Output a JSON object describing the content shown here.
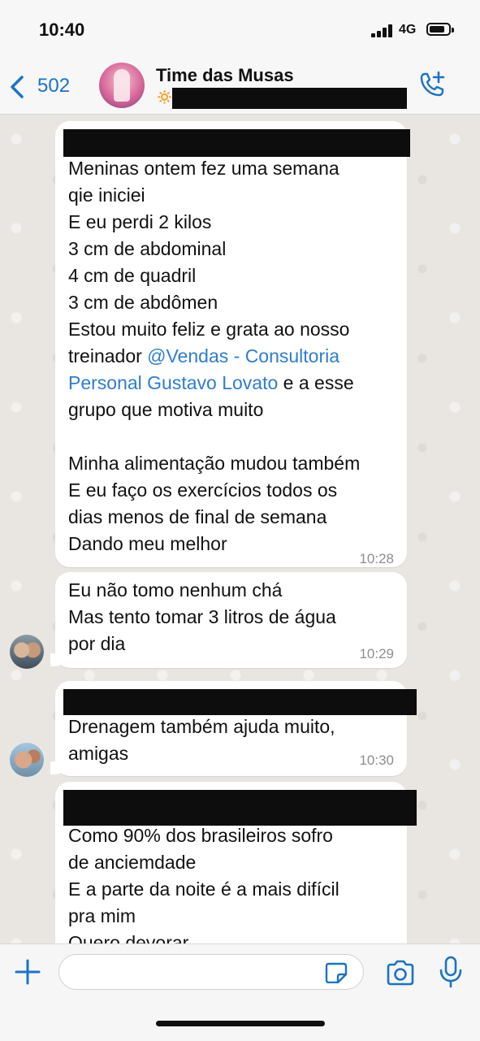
{
  "status_bar": {
    "time": "10:40",
    "network": "4G"
  },
  "header": {
    "back_count": "502",
    "title": "Time das Musas",
    "subtitle_emoji": "🔅"
  },
  "messages": [
    {
      "lines": [
        "Meninas ontem fez uma semana",
        "qie iniciei",
        "E eu perdi 2 kilos",
        "3 cm de abdominal",
        "4 cm de quadril",
        "3 cm de abdômen",
        "Estou muito feliz e grata ao nosso"
      ],
      "mention_prefix": "treinador ",
      "mention_a": "@Vendas - Consultoria",
      "mention_b": "Personal Gustavo Lovato",
      "mention_suffix": " e a esse",
      "lines_after": [
        "grupo que motiva muito",
        "",
        "Minha alimentação mudou também",
        "E eu faço os exercícios todos os",
        "dias menos de final de semana",
        "Dando meu melhor"
      ],
      "time": "10:28"
    },
    {
      "lines": [
        "Eu não tomo nenhum chá",
        "Mas tento tomar 3 litros de água",
        "por dia"
      ],
      "time": "10:29"
    },
    {
      "lines": [
        "Drenagem também ajuda muito,",
        "amigas"
      ],
      "time": "10:30"
    },
    {
      "lines": [
        "Como 90% dos brasileiros sofro",
        "de anciemdade",
        "E a parte da noite é a mais difícil",
        "pra mim",
        "Quero devorar"
      ]
    }
  ]
}
